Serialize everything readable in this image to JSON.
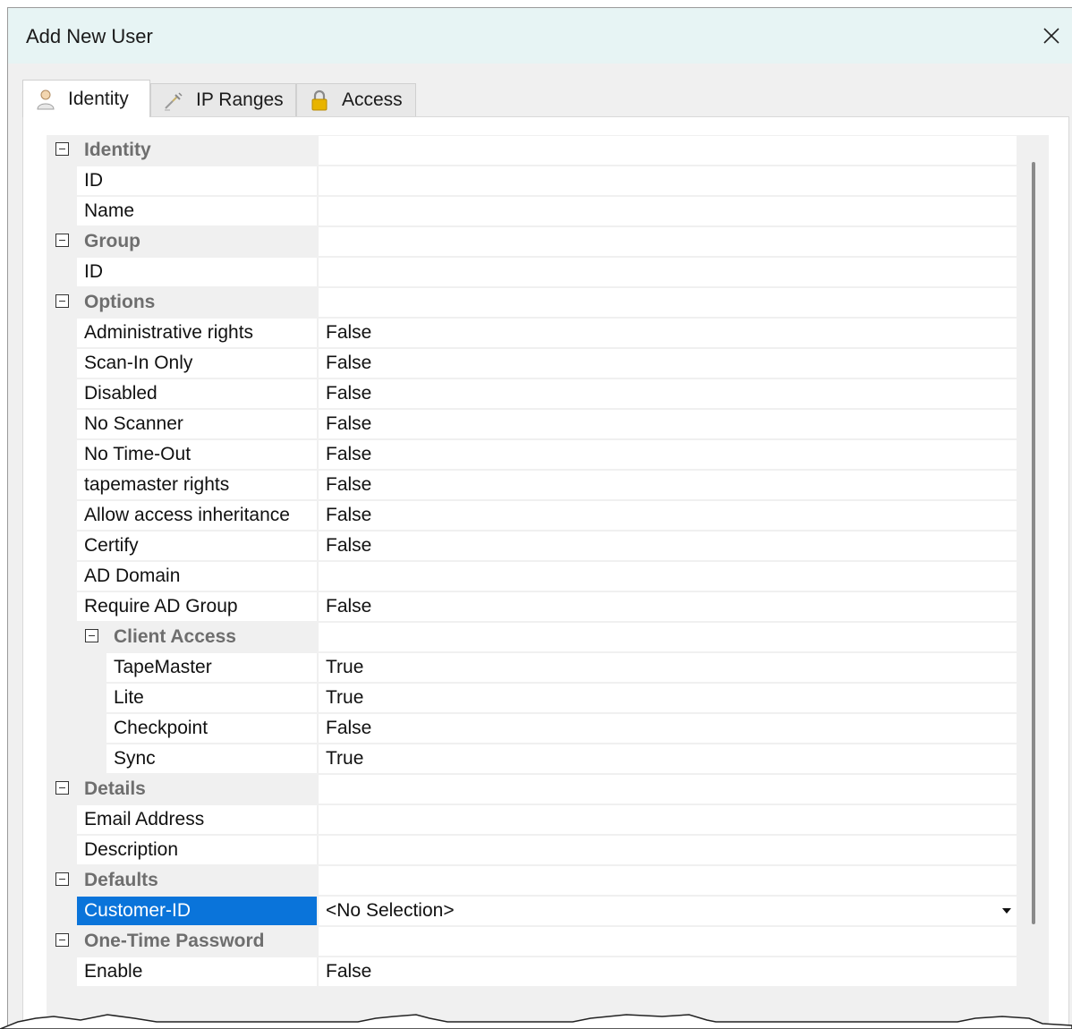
{
  "window": {
    "title": "Add New User",
    "close_glyph": "close-icon"
  },
  "tabs": [
    {
      "label": "Identity",
      "icon": "user-icon",
      "active": true
    },
    {
      "label": "IP Ranges",
      "icon": "network-plug-icon",
      "active": false
    },
    {
      "label": "Access",
      "icon": "padlock-icon",
      "active": false
    }
  ],
  "grid": {
    "rows": [
      {
        "kind": "category",
        "label": "Identity",
        "depth": 0
      },
      {
        "kind": "property",
        "label": "ID",
        "value": "",
        "depth": 0
      },
      {
        "kind": "property",
        "label": "Name",
        "value": "",
        "depth": 0
      },
      {
        "kind": "category",
        "label": "Group",
        "depth": 0
      },
      {
        "kind": "property",
        "label": "ID",
        "value": "",
        "depth": 0
      },
      {
        "kind": "category",
        "label": "Options",
        "depth": 0
      },
      {
        "kind": "property",
        "label": "Administrative rights",
        "value": "False",
        "depth": 0
      },
      {
        "kind": "property",
        "label": "Scan-In Only",
        "value": "False",
        "depth": 0
      },
      {
        "kind": "property",
        "label": "Disabled",
        "value": "False",
        "depth": 0
      },
      {
        "kind": "property",
        "label": "No Scanner",
        "value": "False",
        "depth": 0
      },
      {
        "kind": "property",
        "label": "No Time-Out",
        "value": "False",
        "depth": 0
      },
      {
        "kind": "property",
        "label": "tapemaster rights",
        "value": "False",
        "depth": 0
      },
      {
        "kind": "property",
        "label": "Allow access inheritance",
        "value": "False",
        "depth": 0
      },
      {
        "kind": "property",
        "label": "Certify",
        "value": "False",
        "depth": 0
      },
      {
        "kind": "property",
        "label": "AD Domain",
        "value": "",
        "depth": 0
      },
      {
        "kind": "property",
        "label": "Require AD Group",
        "value": "False",
        "depth": 0
      },
      {
        "kind": "category",
        "label": "Client Access",
        "depth": 1
      },
      {
        "kind": "property",
        "label": "TapeMaster",
        "value": "True",
        "depth": 1
      },
      {
        "kind": "property",
        "label": "Lite",
        "value": "True",
        "depth": 1
      },
      {
        "kind": "property",
        "label": "Checkpoint",
        "value": "False",
        "depth": 1
      },
      {
        "kind": "property",
        "label": "Sync",
        "value": "True",
        "depth": 1
      },
      {
        "kind": "category",
        "label": "Details",
        "depth": 0
      },
      {
        "kind": "property",
        "label": "Email Address",
        "value": "",
        "depth": 0
      },
      {
        "kind": "property",
        "label": "Description",
        "value": "",
        "depth": 0
      },
      {
        "kind": "category",
        "label": "Defaults",
        "depth": 0
      },
      {
        "kind": "property",
        "label": "Customer-ID",
        "value": "<No Selection>",
        "depth": 0,
        "selected": true,
        "dropdown": true
      },
      {
        "kind": "category",
        "label": "One-Time Password",
        "depth": 0
      },
      {
        "kind": "property",
        "label": "Enable",
        "value": "False",
        "depth": 0
      }
    ]
  },
  "colors": {
    "titlebar_bg": "#e7f4f4",
    "selection": "#0a74da",
    "category_text": "#6e6e6e",
    "grid_bg": "#f0f0f0"
  }
}
